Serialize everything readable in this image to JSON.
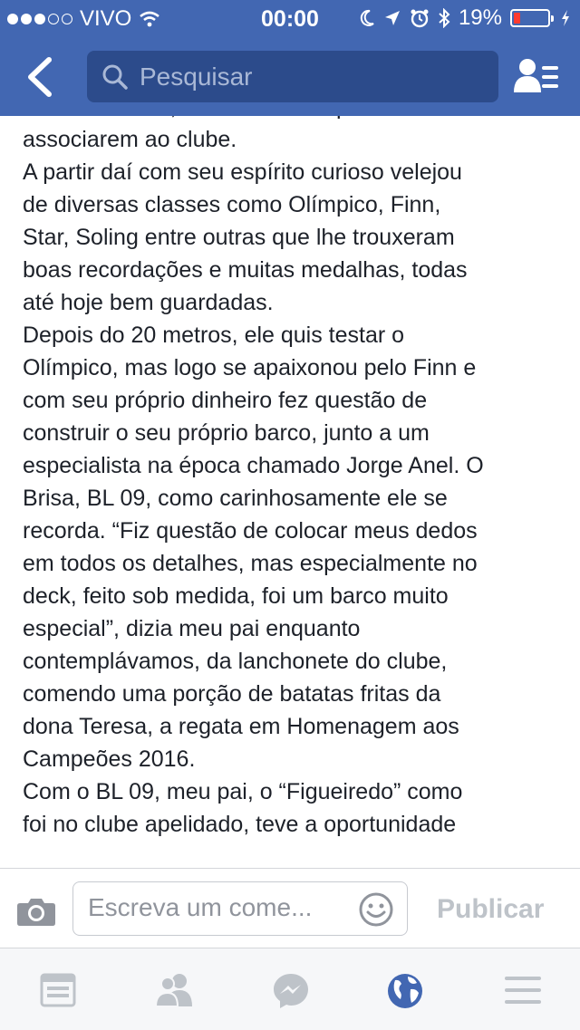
{
  "status_bar": {
    "carrier": "VIVO",
    "time": "00:00",
    "battery_percent": "19%",
    "battery_level": 0.19,
    "icons": [
      "wifi-icon",
      "moon-icon",
      "location-icon",
      "alarm-icon",
      "bluetooth-icon",
      "battery-icon",
      "charging-icon"
    ]
  },
  "header": {
    "search_placeholder": "Pesquisar",
    "icons": [
      "back-chevron-icon",
      "search-icon",
      "friends-list-icon"
    ]
  },
  "post": {
    "lines": [
      "Renato Lemos, os convidaram para se",
      "associarem ao clube.",
      "A partir daí com seu espírito curioso velejou",
      "de diversas classes como Olímpico, Finn,",
      "Star, Soling entre outras que lhe trouxeram",
      "boas recordações e muitas medalhas, todas",
      "até hoje bem guardadas.",
      "Depois do 20 metros, ele quis testar o",
      "Olímpico, mas logo se apaixonou pelo Finn e",
      "com seu próprio dinheiro fez questão de",
      "construir o seu próprio barco, junto a um",
      "especialista na época chamado Jorge Anel. O",
      "Brisa, BL 09, como carinhosamente ele se",
      "recorda. “Fiz questão de colocar meus dedos",
      "em todos os detalhes, mas especialmente no",
      "deck, feito sob medida, foi um barco muito",
      "especial”, dizia meu pai enquanto",
      "contemplávamos, da lanchonete do clube,",
      "comendo uma porção de batatas fritas da",
      "dona Teresa, a regata em Homenagem aos",
      "Campeões 2016.",
      "Com o BL 09, meu pai, o “Figueiredo” como",
      "foi no clube apelidado, teve a oportunidade"
    ]
  },
  "composer": {
    "placeholder": "Escreva um come...",
    "publish_label": "Publicar",
    "icons": [
      "camera-icon",
      "smiley-icon"
    ]
  },
  "tab_bar": {
    "tabs": [
      {
        "name": "news-feed",
        "icon": "news-feed-icon",
        "active": false
      },
      {
        "name": "friend-requests",
        "icon": "friends-icon",
        "active": false
      },
      {
        "name": "messenger",
        "icon": "messenger-icon",
        "active": false
      },
      {
        "name": "notifications",
        "icon": "globe-icon",
        "active": true
      },
      {
        "name": "more",
        "icon": "menu-icon",
        "active": false
      }
    ]
  },
  "colors": {
    "brand": "#4267b2",
    "search_bg": "#2c4b8b",
    "text": "#1d2129",
    "tab_inactive": "#bec3c9",
    "tab_active": "#4267b2",
    "battery_low": "#ff3b30"
  }
}
